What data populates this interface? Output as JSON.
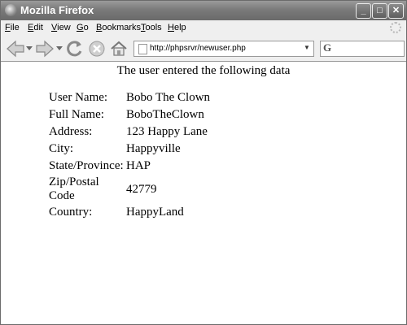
{
  "window": {
    "title": "Mozilla Firefox",
    "minimize": "_",
    "maximize": "□",
    "close": "✕"
  },
  "menu": {
    "items": [
      "File",
      "Edit",
      "View",
      "Go",
      "Bookmarks",
      "Tools",
      "Help"
    ],
    "underline": [
      "F",
      "E",
      "V",
      "G",
      "B",
      "T",
      "H"
    ]
  },
  "toolbar": {
    "url": "http://phpsrvr/newuser.php",
    "icons": [
      "back-icon",
      "back-dropdown-icon",
      "forward-icon",
      "forward-dropdown-icon",
      "reload-icon",
      "stop-icon",
      "home-icon",
      "page-icon",
      "url-dropdown-icon",
      "search-engine-icon"
    ]
  },
  "page": {
    "heading": "The user entered the following data",
    "rows": [
      {
        "label": "User Name:",
        "value": "Bobo The Clown"
      },
      {
        "label": "Full Name:",
        "value": "BoboTheClown"
      },
      {
        "label": "Address:",
        "value": "123 Happy Lane"
      },
      {
        "label": "City:",
        "value": "Happyville"
      },
      {
        "label": "State/Province:",
        "value": "HAP"
      },
      {
        "label": "Zip/Postal Code",
        "value": "42779"
      },
      {
        "label": "Country:",
        "value": "HappyLand"
      }
    ]
  }
}
